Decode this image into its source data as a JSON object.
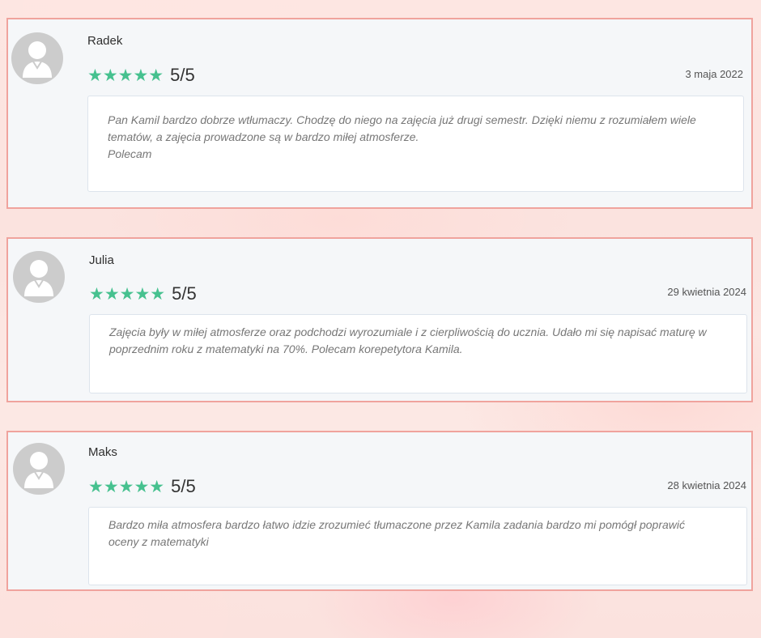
{
  "reviews": [
    {
      "author": "Radek",
      "stars": 5,
      "star_glyphs": "★★★★★",
      "score": "5/5",
      "date": "3 maja 2022",
      "text": "Pan Kamil bardzo dobrze wtłumaczy. Chodzę do niego na zajęcia już drugi semestr. Dzięki niemu z rozumiałem wiele\ntematów, a zajęcia prowadzone są w bardzo miłej atmosferze.\nPolecam"
    },
    {
      "author": "Julia",
      "stars": 5,
      "star_glyphs": "★★★★★",
      "score": "5/5",
      "date": "29 kwietnia 2024",
      "text": "Zajęcia były w miłej atmosferze oraz podchodzi wyrozumiale i z cierpliwością do ucznia. Udało mi się napisać maturę w\npoprzednim roku z matematyki na 70%. Polecam korepetytora Kamila."
    },
    {
      "author": "Maks",
      "stars": 5,
      "star_glyphs": "★★★★★",
      "score": "5/5",
      "date": "28 kwietnia 2024",
      "text": "Bardzo miła atmosfera bardzo łatwo idzie zrozumieć tłumaczone przez Kamila zadania bardzo mi pomógł poprawić\noceny z matematyki"
    }
  ],
  "colors": {
    "star": "#46c18f",
    "card_border": "#f0a39d",
    "card_background": "#f5f7f9",
    "avatar": "#cccccc"
  }
}
